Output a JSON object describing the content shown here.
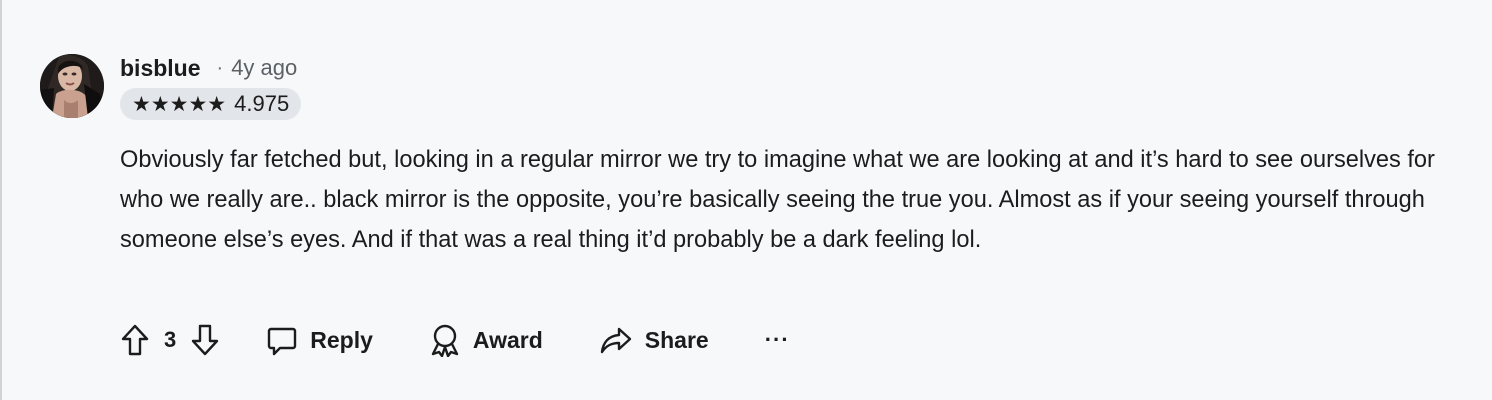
{
  "comment": {
    "author": "bisblue",
    "separator": "·",
    "timestamp": "4y ago",
    "flair": {
      "stars": "★★★★★",
      "rating": "4.975"
    },
    "body": "Obviously far fetched but, looking in a regular mirror we try to imagine what we are looking at and it’s hard to see ourselves for who we really are.. black mirror is the opposite, you’re basically seeing the true you. Almost as if your seeing yourself through someone else’s eyes. And if that was a real thing it’d probably be a dark feeling lol.",
    "score": "3"
  },
  "actions": {
    "reply_label": "Reply",
    "award_label": "Award",
    "share_label": "Share",
    "more_label": "···"
  },
  "icons": {
    "upvote": "arrow-up-icon",
    "downvote": "arrow-down-icon",
    "reply": "speech-bubble-icon",
    "award": "award-ribbon-icon",
    "share": "share-arrow-icon",
    "more": "ellipsis-icon"
  },
  "colors": {
    "background": "#f7f8fa",
    "flair_background": "#e2e5e9",
    "text": "#1c1c1c",
    "muted": "#5c6166"
  }
}
